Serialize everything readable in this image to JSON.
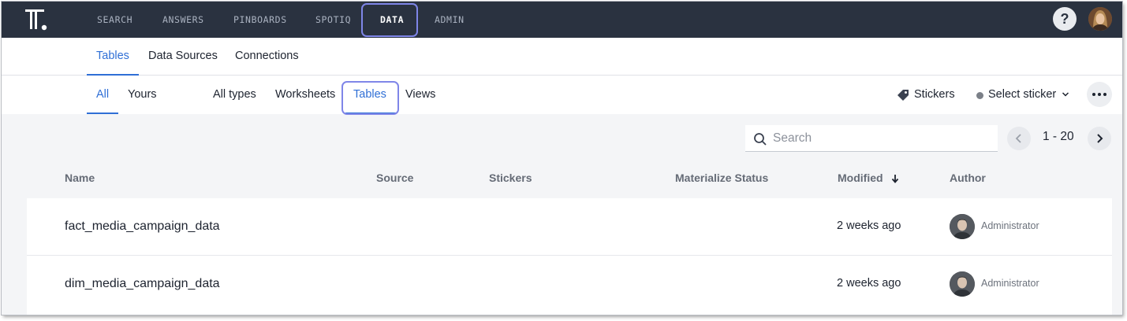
{
  "top_nav": {
    "items": [
      {
        "label": "SEARCH",
        "active": false
      },
      {
        "label": "ANSWERS",
        "active": false
      },
      {
        "label": "PINBOARDS",
        "active": false
      },
      {
        "label": "SPOTIQ",
        "active": false
      },
      {
        "label": "DATA",
        "active": true
      },
      {
        "label": "ADMIN",
        "active": false
      }
    ],
    "help_label": "?",
    "logo_icon": "thoughtspot-logo-icon",
    "avatar_icon": "user-avatar"
  },
  "sub_nav": {
    "tabs": [
      {
        "label": "Tables",
        "active": true
      },
      {
        "label": "Data Sources",
        "active": false
      },
      {
        "label": "Connections",
        "active": false
      }
    ]
  },
  "filter_bar": {
    "ownership": [
      {
        "label": "All",
        "active": true
      },
      {
        "label": "Yours",
        "active": false
      }
    ],
    "types": [
      {
        "label": "All types",
        "active": false
      },
      {
        "label": "Worksheets",
        "active": false
      },
      {
        "label": "Tables",
        "active": true
      },
      {
        "label": "Views",
        "active": false
      }
    ],
    "stickers_label": "Stickers",
    "stickers_icon": "tag-icon",
    "select_sticker_label": "Select sticker",
    "more_icon": "ellipsis-icon"
  },
  "search": {
    "placeholder": "Search",
    "value": ""
  },
  "pagination": {
    "range": "1 - 20"
  },
  "table": {
    "columns": [
      "Name",
      "Source",
      "Stickers",
      "Materialize Status",
      "Modified",
      "Author"
    ],
    "sort_column": "Modified",
    "sort_direction": "descending",
    "rows": [
      {
        "name": "fact_media_campaign_data",
        "source": "",
        "stickers": "",
        "materialize_status": "",
        "modified": "2 weeks ago",
        "author": "Administrator"
      },
      {
        "name": "dim_media_campaign_data",
        "source": "",
        "stickers": "",
        "materialize_status": "",
        "modified": "2 weeks ago",
        "author": "Administrator"
      }
    ]
  },
  "colors": {
    "nav_background": "#2a3240",
    "accent": "#2f6fd6",
    "highlight_outline": "#7f86e8",
    "page_background": "#f4f5f7"
  }
}
